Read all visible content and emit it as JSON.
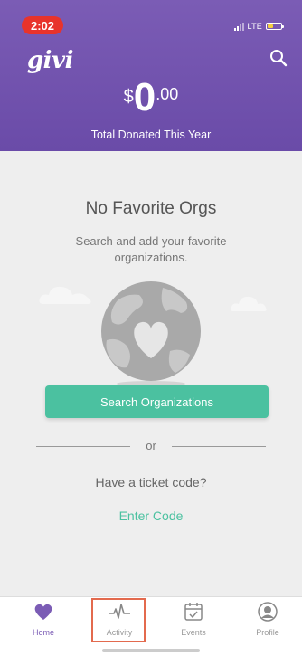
{
  "status_bar": {
    "time": "2:02",
    "network": "LTE"
  },
  "header": {
    "logo": "givi",
    "currency_symbol": "$",
    "amount_whole": "0",
    "amount_cents": ".00",
    "total_label": "Total Donated This Year",
    "background_color": "#6f50ad"
  },
  "empty_state": {
    "title": "No Favorite Orgs",
    "subtitle": "Search and add your favorite organizations.",
    "search_button_label": "Search Organizations",
    "divider_text": "or",
    "ticket_prompt": "Have a ticket code?",
    "enter_code_label": "Enter Code"
  },
  "colors": {
    "accent_green": "#4bc1a0",
    "brand_purple": "#7b5cb5",
    "highlight_box": "#e36a4e"
  },
  "tabbar": {
    "tabs": [
      {
        "label": "Home",
        "icon": "heart-icon",
        "active": true
      },
      {
        "label": "Activity",
        "icon": "activity-pulse-icon",
        "active": false
      },
      {
        "label": "Events",
        "icon": "calendar-check-icon",
        "active": false
      },
      {
        "label": "Profile",
        "icon": "profile-icon",
        "active": false
      }
    ]
  }
}
